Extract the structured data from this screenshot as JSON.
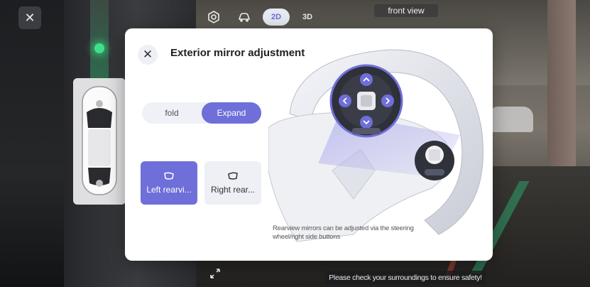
{
  "topbar": {
    "close_icon": "close-icon",
    "view_2d": "2D",
    "view_3d": "3D",
    "front_view": "front view",
    "settings_icon": "hexagon-gear-icon",
    "car_icon": "car-mirror-icon"
  },
  "dialog": {
    "title": "Exterior mirror adjustment",
    "fold_label": "fold",
    "expand_label": "Expand",
    "selected_mode": "Expand",
    "left_mirror_label": "Left rearvi...",
    "right_mirror_label": "Right rear...",
    "selected_mirror": "left",
    "hint": "Rearview mirrors can be adjusted via the steering wheel/right side buttons",
    "accent": "#6f6fd9"
  },
  "footer": {
    "safety_message": "Please check your surroundings to ensure safety!"
  }
}
